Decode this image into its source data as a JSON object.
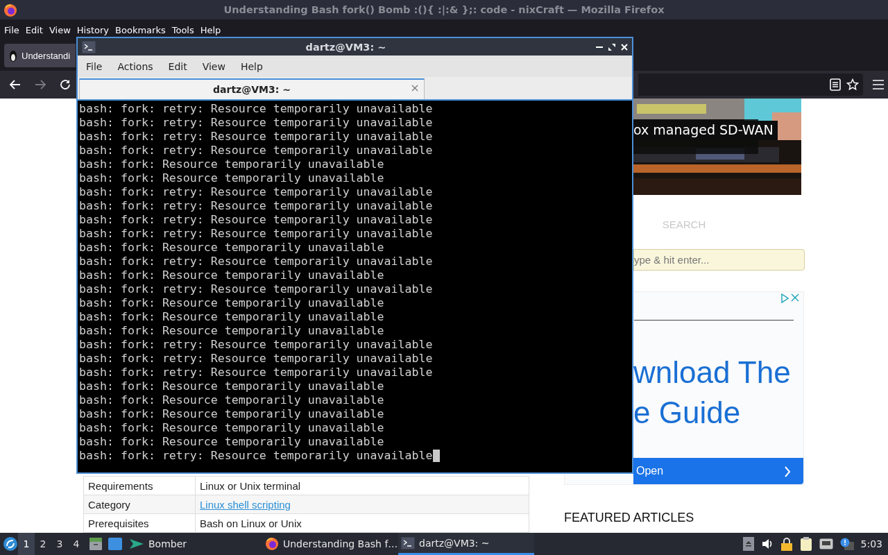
{
  "firefox": {
    "title": "Understanding Bash fork() Bomb :(){ :|:& };: code - nixCraft — Mozilla Firefox",
    "menu": [
      "File",
      "Edit",
      "View",
      "History",
      "Bookmarks",
      "Tools",
      "Help"
    ],
    "tabs": [
      {
        "label": "Understandi",
        "selected": true
      }
    ],
    "nav_buttons": [
      {
        "kind": "back",
        "disabled": false
      },
      {
        "kind": "forward",
        "disabled": true
      },
      {
        "kind": "reload",
        "disabled": false
      }
    ],
    "url_actions": [
      {
        "kind": "reader"
      },
      {
        "kind": "bookmark"
      }
    ],
    "page": {
      "banner": {
        "caption": "ox managed SD-WAN"
      },
      "search": {
        "label": "SEARCH",
        "placeholder": "ype & hit enter..."
      },
      "ad": {
        "headline": [
          "wnload The",
          "e Guide"
        ],
        "button": "Open"
      },
      "featured": "FEATURED ARTICLES",
      "table": [
        {
          "label": "Requirements",
          "value": "Linux or Unix terminal",
          "kind": "text"
        },
        {
          "label": "Category",
          "value": "Linux shell scripting",
          "kind": "link"
        },
        {
          "label": "Prerequisites",
          "value": "Bash on Linux or Unix",
          "kind": "text"
        }
      ]
    }
  },
  "terminal": {
    "title": "dartz@VM3: ~",
    "menu": [
      "File",
      "Actions",
      "Edit",
      "View",
      "Help"
    ],
    "tabs": [
      {
        "label": "dartz@VM3: ~",
        "selected": true
      }
    ],
    "lines": [
      "bash: fork: retry: Resource temporarily unavailable",
      "bash: fork: retry: Resource temporarily unavailable",
      "bash: fork: retry: Resource temporarily unavailable",
      "bash: fork: retry: Resource temporarily unavailable",
      "bash: fork: Resource temporarily unavailable",
      "bash: fork: Resource temporarily unavailable",
      "bash: fork: retry: Resource temporarily unavailable",
      "bash: fork: retry: Resource temporarily unavailable",
      "bash: fork: retry: Resource temporarily unavailable",
      "bash: fork: retry: Resource temporarily unavailable",
      "bash: fork: Resource temporarily unavailable",
      "bash: fork: retry: Resource temporarily unavailable",
      "bash: fork: Resource temporarily unavailable",
      "bash: fork: retry: Resource temporarily unavailable",
      "bash: fork: Resource temporarily unavailable",
      "bash: fork: Resource temporarily unavailable",
      "bash: fork: Resource temporarily unavailable",
      "bash: fork: retry: Resource temporarily unavailable",
      "bash: fork: retry: Resource temporarily unavailable",
      "bash: fork: retry: Resource temporarily unavailable",
      "bash: fork: Resource temporarily unavailable",
      "bash: fork: Resource temporarily unavailable",
      "bash: fork: Resource temporarily unavailable",
      "bash: fork: Resource temporarily unavailable",
      "bash: fork: Resource temporarily unavailable",
      "bash: fork: retry: Resource temporarily unavailable"
    ],
    "cursor": true
  },
  "taskbar": {
    "workspaces": [
      {
        "label": "1",
        "selected": true
      },
      {
        "label": "2",
        "selected": false
      },
      {
        "label": "3",
        "selected": false
      },
      {
        "label": "4",
        "selected": false
      }
    ],
    "launchers": [
      {
        "kind": "files"
      },
      {
        "kind": "desktop"
      }
    ],
    "tasks": [
      {
        "label": "Bomber",
        "kind": "game",
        "selected": false
      },
      {
        "label": "Understanding Bash f…",
        "kind": "firefox",
        "selected": false
      },
      {
        "label": "dartz@VM3: ~",
        "kind": "terminal",
        "selected": true
      }
    ],
    "tray": [
      {
        "kind": "eject"
      },
      {
        "kind": "volume"
      },
      {
        "kind": "lock"
      },
      {
        "kind": "clipboard"
      },
      {
        "kind": "network"
      },
      {
        "kind": "notification"
      }
    ],
    "clock": "5:03"
  }
}
